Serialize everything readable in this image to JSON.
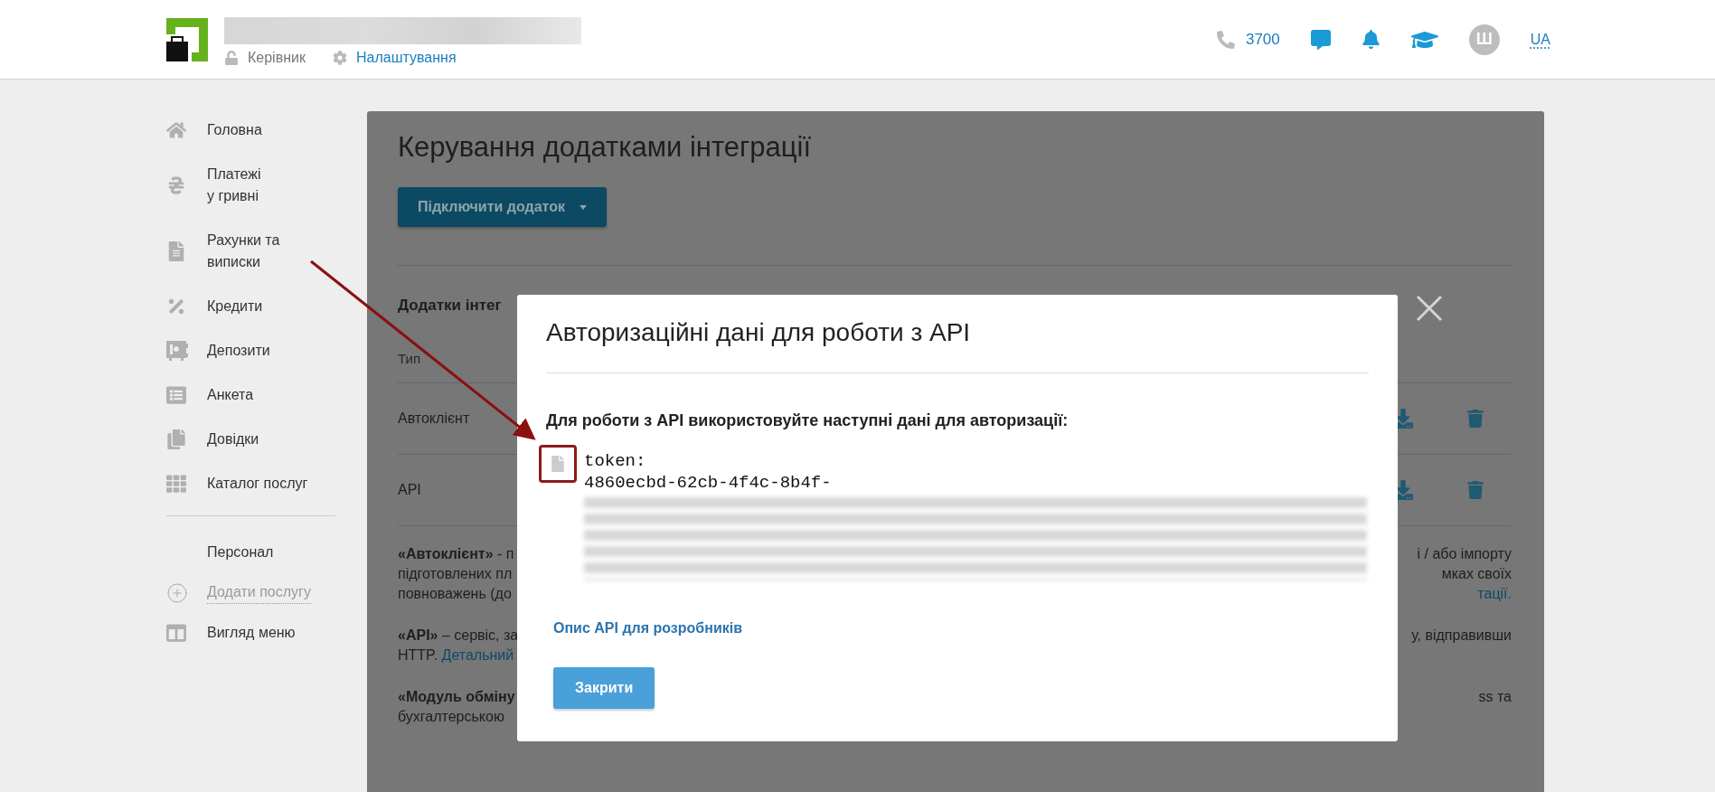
{
  "header": {
    "role": "Керівник",
    "settings": "Налаштування",
    "phone": "3700",
    "avatar_letter": "Ш",
    "language": {
      "label": "UA",
      "selected": true
    }
  },
  "sidebar": {
    "items": [
      {
        "label": "Головна"
      },
      {
        "label": "Платежі\nу гривні"
      },
      {
        "label": "Рахунки та\nвиписки"
      },
      {
        "label": "Кредити"
      },
      {
        "label": "Депозити"
      },
      {
        "label": "Анкета"
      },
      {
        "label": "Довідки"
      },
      {
        "label": "Каталог послуг"
      }
    ],
    "staff": "Персонал",
    "add_service": "Додати послугу",
    "menu_view": "Вигляд меню"
  },
  "page": {
    "title": "Керування додатками інтеграції",
    "connect_button": "Підключити додаток",
    "section_title": "Додатки інтег",
    "column_type": "Тип",
    "rows": [
      {
        "type": "Автоклієнт"
      },
      {
        "type": "API"
      }
    ],
    "paragraphs": [
      [
        {
          "left": "**«Автоклієнт»** - п",
          "right": "і / або імпорту"
        },
        {
          "left": "підготовлених пл",
          "right": "мках своїх"
        },
        {
          "left": "повноважень (до",
          "right_link": "тації."
        }
      ],
      [
        {
          "left": "**«API»** – сервіс, за",
          "right": "у, відправивши"
        },
        {
          "left": "HTTP. ",
          "left_link": "Детальний"
        }
      ],
      [
        {
          "left": "**«Модуль обміну**",
          "right": "ss та"
        },
        {
          "left": "бухгалтерською"
        }
      ]
    ]
  },
  "modal": {
    "title": "Авторизаційні дані для роботи з API",
    "intro": "Для роботи з API використовуйте наступні дані для авторизації:",
    "token_label": "token:",
    "token_value": "4860ecbd-62cb-4f4c-8b4f-",
    "docs_link": "Опис API для розробників",
    "close_button": "Закрити"
  }
}
